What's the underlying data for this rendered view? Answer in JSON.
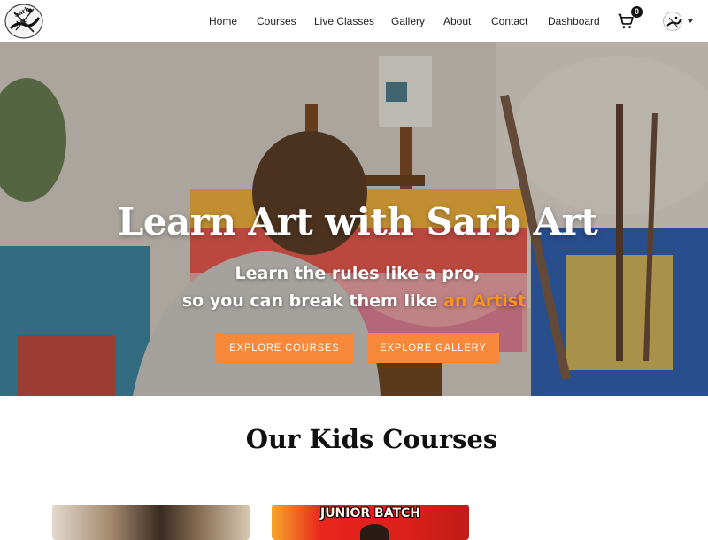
{
  "navbar": {
    "logo_text": "Sarb Art",
    "links": [
      {
        "label": "Home"
      },
      {
        "label": "Courses"
      },
      {
        "label": "Live Classes"
      },
      {
        "label": "Gallery"
      },
      {
        "label": "About"
      },
      {
        "label": "Contact"
      },
      {
        "label": "Dashboard"
      }
    ],
    "cart": {
      "icon": "cart-icon",
      "count": "0"
    },
    "account": {
      "icon": "avatar",
      "menu_icon": "caret-down-icon"
    }
  },
  "hero": {
    "title": "Learn Art with Sarb Art",
    "subtitle_line1": "Learn the rules like a pro,",
    "subtitle_line2_prefix": "so you can break them like ",
    "subtitle_line2_accent": "an Artist",
    "buttons": {
      "primary": "EXPLORE COURSES",
      "secondary": "EXPLORE GALLERY"
    }
  },
  "kids_section": {
    "title": "Our Kids Courses",
    "cards": [
      {
        "label": ""
      },
      {
        "label": "JUNIOR BATCH"
      }
    ]
  },
  "colors": {
    "accent": "#f7931e",
    "button": "#f8893a",
    "nav_text": "#222222"
  }
}
